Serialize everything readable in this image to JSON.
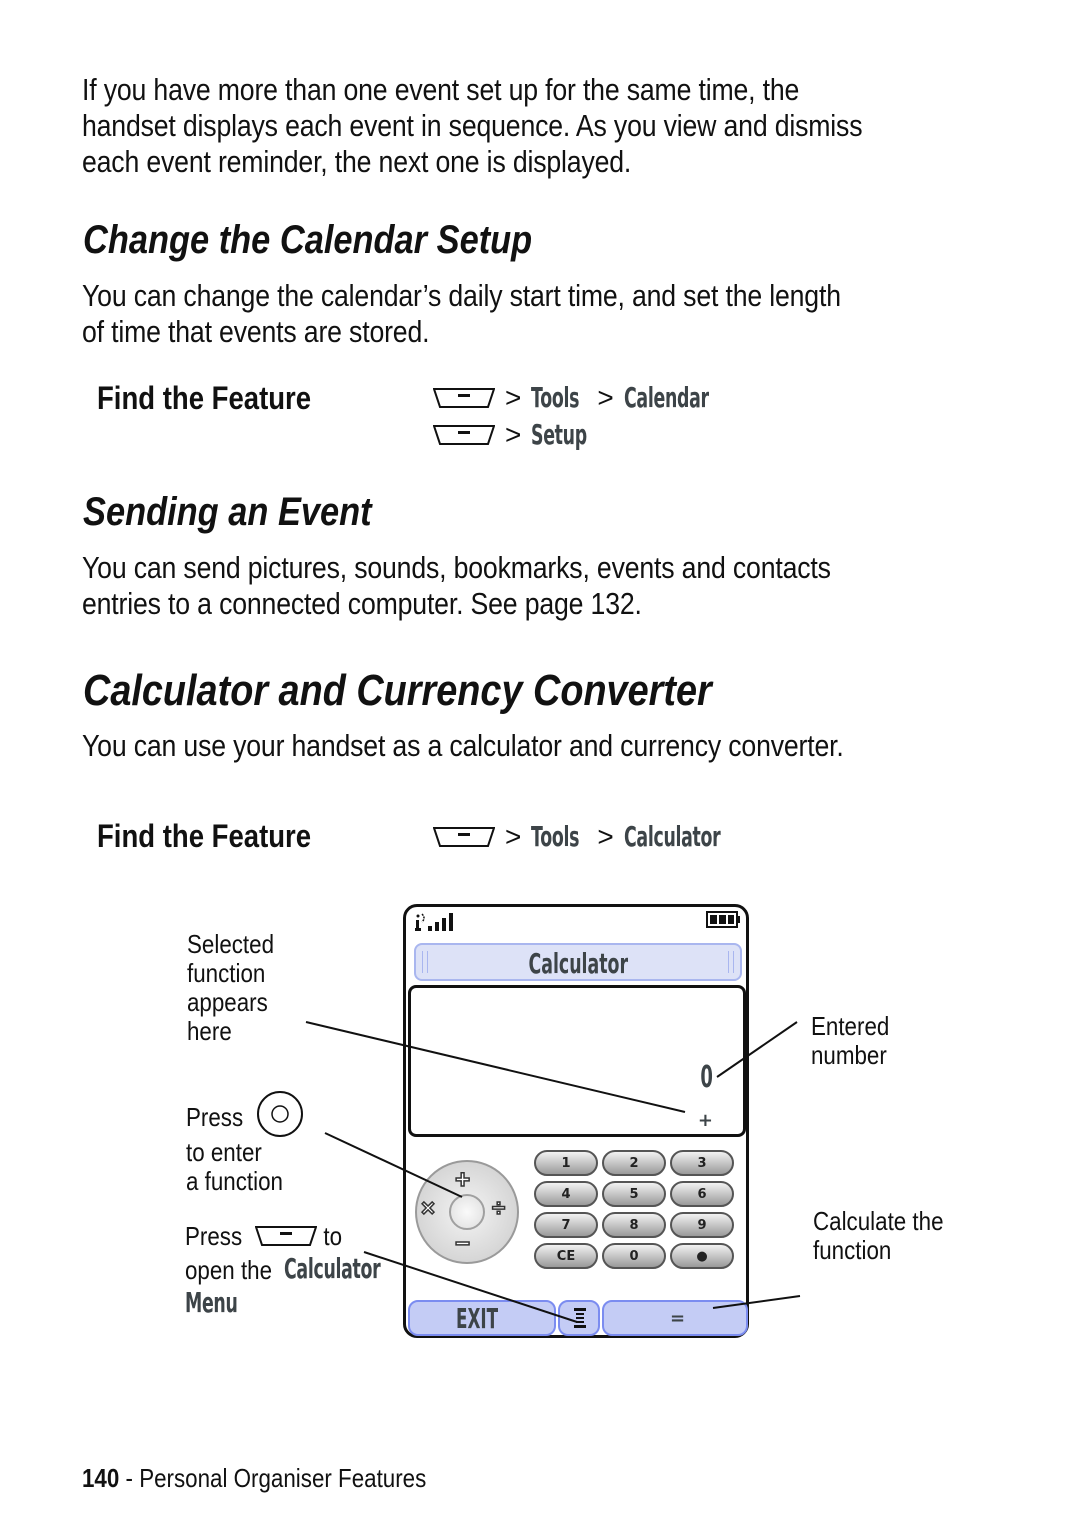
{
  "intro_paragraph": [
    "If you have more than one event set up for the same time, the",
    "handset displays each event in sequence. As you view and dismiss",
    "each event reminder, the next one is displayed."
  ],
  "sections": {
    "calendar_setup": {
      "title": "Change the Calendar Setup",
      "paragraph": [
        "You can change the calendar’s daily start time, and set the length",
        "of time that events are stored."
      ],
      "find_feature": {
        "label": "Find the Feature",
        "rows": [
          {
            "separator": ">",
            "items": [
              "Tools",
              "Calendar"
            ]
          },
          {
            "separator": ">",
            "items": [
              "Setup"
            ]
          }
        ]
      }
    },
    "sending_event": {
      "title": "Sending an Event",
      "paragraph": [
        "You can send pictures, sounds, bookmarks, events and contacts",
        "entries to a connected computer. See page 132."
      ]
    },
    "calculator": {
      "title": "Calculator and Currency Converter",
      "paragraph": [
        "You can use your handset as a calculator and currency converter."
      ],
      "find_feature": {
        "label": "Find the Feature",
        "rows": [
          {
            "separator": ">",
            "items": [
              "Tools",
              "Calculator"
            ]
          }
        ]
      }
    }
  },
  "phone": {
    "title": "Calculator",
    "display_value": "0",
    "selected_function": "+",
    "nav_functions": {
      "up": "+",
      "down": "−",
      "left": "×",
      "right": "÷"
    },
    "keypad": [
      "1",
      "2",
      "3",
      "4",
      "5",
      "6",
      "7",
      "8",
      "9",
      "CE",
      "0",
      "●"
    ],
    "soft_left": "EXIT",
    "soft_right": "=",
    "menu_icon": "menu-icon",
    "colors": {
      "title_bg": "#dde2f7",
      "softkey_bg": "#c4ccf5",
      "softkey_border": "#7b8cf0",
      "display_text": "#3d4448"
    }
  },
  "callouts": {
    "selected_function": [
      "Selected",
      "function",
      "appears",
      "here"
    ],
    "press_nav": {
      "line1": "Press",
      "line2": "to enter",
      "line3": "a function"
    },
    "press_menu": {
      "before": "Press",
      "after": "to",
      "line2_prefix": "open the",
      "menu_name_1": "Calculator",
      "menu_name_2": "Menu"
    },
    "entered_number": [
      "Entered",
      "number"
    ],
    "calculate": [
      "Calculate the",
      "function"
    ]
  },
  "footer": {
    "page_number": "140",
    "separator": " - ",
    "section": "Personal Organiser Features"
  }
}
